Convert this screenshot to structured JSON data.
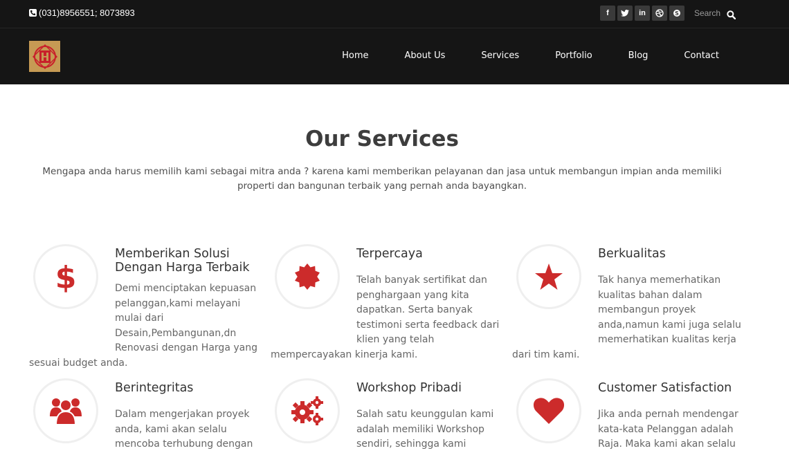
{
  "topbar": {
    "phone": "(031)8956551; 8073893",
    "socials": [
      "facebook-icon",
      "twitter-icon",
      "linkedin-icon",
      "dribbble-icon",
      "skype-icon"
    ],
    "search_placeholder": "Search"
  },
  "nav": {
    "items": [
      "Home",
      "About Us",
      "Services",
      "Portfolio",
      "Blog",
      "Contact"
    ]
  },
  "intro": {
    "title": "Our Services",
    "description": "Mengapa anda harus memilih kami sebagai mitra anda ? karena kami memberikan pelayanan dan jasa untuk membangun impian anda memiliki properti dan bangunan terbaik yang pernah anda bayangkan."
  },
  "services": [
    {
      "title": "Memberikan Solusi Dengan Harga Terbaik",
      "text": "Demi menciptakan kepuasan pelanggan,kami melayani mulai dari Desain,Pembangunan,dn Renovasi dengan Harga yang sesuai budget anda.",
      "icon": "dollar-icon"
    },
    {
      "title": "Terpercaya",
      "text": "Telah banyak sertifikat dan penghargaan yang kita dapatkan. Serta banyak testimoni serta feedback dari klien yang telah mempercayakan kinerja kami.",
      "icon": "certificate-icon"
    },
    {
      "title": "Berkualitas",
      "text": "Tak hanya memerhatikan kualitas bahan dalam membangun proyek anda,namun kami juga selalu memerhatikan kualitas kerja dari tim kami.",
      "icon": "star-icon"
    },
    {
      "title": "Berintegritas",
      "text": "Dalam mengerjakan proyek anda, kami akan selalu mencoba terhubung dengan",
      "icon": "users-icon"
    },
    {
      "title": "Workshop Pribadi",
      "text": "Salah satu keunggulan kami adalah memiliki Workshop sendiri, sehingga kami",
      "icon": "gears-icon"
    },
    {
      "title": "Customer Satisfaction",
      "text": "Jika anda pernah mendengar kata-kata Pelanggan adalah Raja. Maka kami akan selalu",
      "icon": "heart-icon"
    }
  ],
  "colors": {
    "header_bg": "#151515",
    "accent": "#cc2b2b",
    "text": "#666666"
  }
}
